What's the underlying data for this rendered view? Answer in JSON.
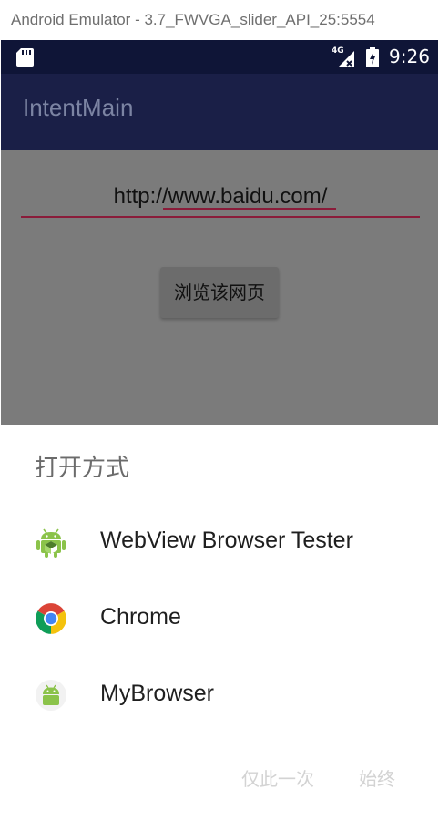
{
  "window": {
    "title": "Android Emulator - 3.7_FWVGA_slider_API_25:5554"
  },
  "status_bar": {
    "network": "4G",
    "time": "9:26"
  },
  "app_bar": {
    "title": "IntentMain"
  },
  "main": {
    "url_value": "http://www.baidu.com/",
    "browse_button": "浏览该网页"
  },
  "chooser": {
    "title": "打开方式",
    "items": [
      {
        "label": "WebView Browser Tester",
        "icon": "android-webview-icon"
      },
      {
        "label": "Chrome",
        "icon": "chrome-icon"
      },
      {
        "label": "MyBrowser",
        "icon": "android-icon"
      }
    ],
    "just_once": "仅此一次",
    "always": "始终"
  },
  "colors": {
    "status_bar": "#0f1537",
    "app_bar": "#1a1f47",
    "accent_underline": "#8a1c3a",
    "dim_overlay": "#7b7b7b"
  }
}
